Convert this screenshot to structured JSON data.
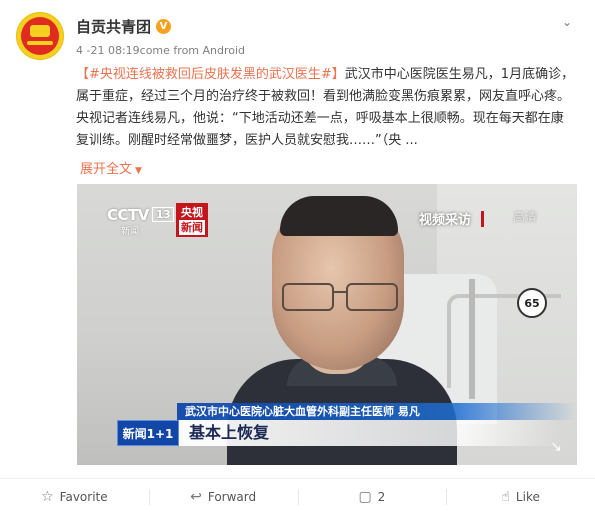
{
  "post": {
    "author": "自贡共青团",
    "verified_badge": "V",
    "meta": "4 -21 08:19come from Android",
    "topic": "【#央视连线被救回后皮肤发黑的武汉医生#】",
    "body": "武汉市中心医院医生易凡，1月底确诊，属于重症，经过三个月的治疗终于被救回！看到他满脸变黑伤痕累累，网友直呼心疼。央视记者连线易凡，他说：“下地活动还差一点，呼吸基本上很顺畅。现在每天都在康复训练。刚醒时经常做噩梦，医护人员就安慰我……”（央 ...",
    "expand_label": "展开全文",
    "more_icon": "chevron-down-icon"
  },
  "video": {
    "cctv_logo": "CCTV",
    "cctv_channel": "13",
    "cctv_sub": "新闻",
    "yangshi_top": "央视",
    "yangshi_bottom": "新闻",
    "tag": "视频采访",
    "hd": "高清",
    "speed_sign": "65",
    "lower_third_title": "武汉市中心医院心脏大血管外科副主任医师 易凡",
    "news_box": "新闻1+1",
    "caption": "基本上恢复"
  },
  "actions": {
    "favorite": "Favorite",
    "forward": "Forward",
    "comments": "2",
    "like": "Like"
  },
  "colors": {
    "topic": "#eb7350",
    "badge": "#f7a21d",
    "news_blue": "#1247a8"
  }
}
